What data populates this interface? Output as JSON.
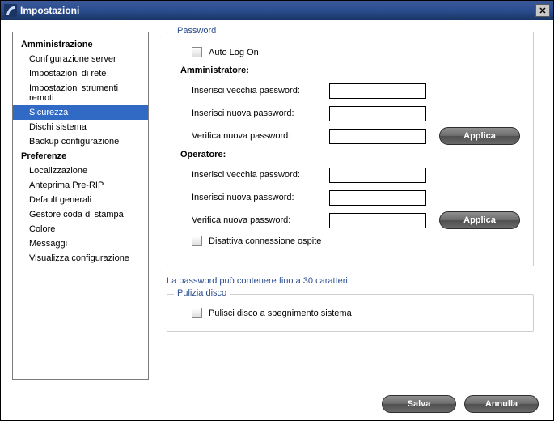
{
  "window": {
    "title": "Impostazioni"
  },
  "sidebar": {
    "section_admin": "Amministrazione",
    "items_admin": [
      "Configurazione server",
      "Impostazioni di rete",
      "Impostazioni strumenti remoti",
      "Sicurezza",
      "Dischi sistema",
      "Backup configurazione"
    ],
    "section_pref": "Preferenze",
    "items_pref": [
      "Localizzazione",
      "Anteprima Pre-RIP",
      "Default generali",
      "Gestore coda di stampa",
      "Colore",
      "Messaggi",
      "Visualizza configurazione"
    ],
    "selected": "Sicurezza"
  },
  "password": {
    "legend": "Password",
    "auto_log_on": "Auto Log On",
    "admin_header": "Amministratore:",
    "operator_header": "Operatore:",
    "old_pw": "Inserisci vecchia password:",
    "new_pw": "Inserisci nuova password:",
    "verify_pw": "Verifica nuova password:",
    "apply": "Applica",
    "disable_guest": "Disattiva connessione ospite",
    "note": "La password può contenere fino a 30 caratteri"
  },
  "disk": {
    "legend": "Pulizia disco",
    "scrub": "Pulisci disco a spegnimento sistema"
  },
  "buttons": {
    "save": "Salva",
    "cancel": "Annulla"
  }
}
